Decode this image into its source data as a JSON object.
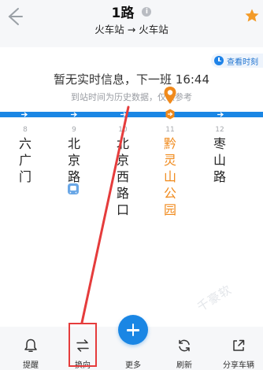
{
  "header": {
    "title": "1路",
    "subtitle": "火车站 → 火车站",
    "info_icon": "i",
    "star_color": "#f39b29"
  },
  "notice": {
    "timetable_label": "查看时刻",
    "no_realtime": "暂无实时信息，下一班 16:44",
    "note": "到站时间为历史数据，仅供参考"
  },
  "stations": [
    {
      "num": "8",
      "name": "六广门"
    },
    {
      "num": "9",
      "name": "北京路",
      "subway": true
    },
    {
      "num": "10",
      "name": "北京西路口"
    },
    {
      "num": "11",
      "name": "黔灵山公园",
      "current": true
    },
    {
      "num": "12",
      "name": "枣山路"
    }
  ],
  "watermark": "千豪软",
  "bottom_bar": {
    "remind": "提醒",
    "reverse": "换向",
    "more": "更多",
    "refresh": "刷新",
    "share": "分享车辆"
  },
  "colors": {
    "accent": "#1a86e4",
    "current_station": "#f08a1c",
    "annotation": "#e53c3c"
  },
  "icons": [
    "back-arrow-icon",
    "info-icon",
    "star-icon",
    "clock-icon",
    "direction-arrow-icon",
    "location-pin-icon",
    "subway-icon",
    "bell-icon",
    "swap-icon",
    "plus-icon",
    "refresh-icon",
    "share-icon"
  ]
}
